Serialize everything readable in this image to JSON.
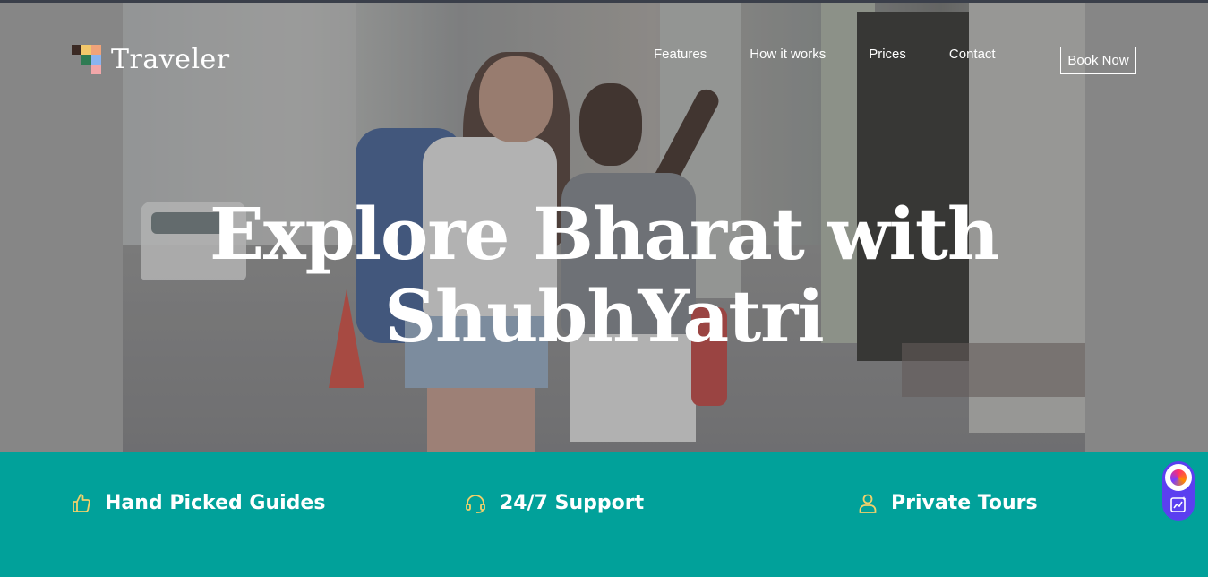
{
  "brand": {
    "name": "Traveler",
    "logo_colors": [
      "#3b2a24",
      "#f4c86b",
      "#f0a37a",
      "#2f7b53",
      "#8ab4f0",
      "#f2a7a9"
    ]
  },
  "nav": {
    "items": [
      "Features",
      "How it works",
      "Prices",
      "Contact"
    ],
    "cta_label": "Book Now"
  },
  "hero": {
    "headline_line1": "Explore Bharat with",
    "headline_line2": "ShubhYatri"
  },
  "features": [
    {
      "icon": "thumbs-up-icon",
      "label": "Hand Picked Guides"
    },
    {
      "icon": "headset-icon",
      "label": "24/7 Support"
    },
    {
      "icon": "user-icon",
      "label": "Private Tours"
    }
  ],
  "colors": {
    "band": "#01a19a",
    "icon_accent": "#f1d06b",
    "widget": "#5b3ff0"
  }
}
